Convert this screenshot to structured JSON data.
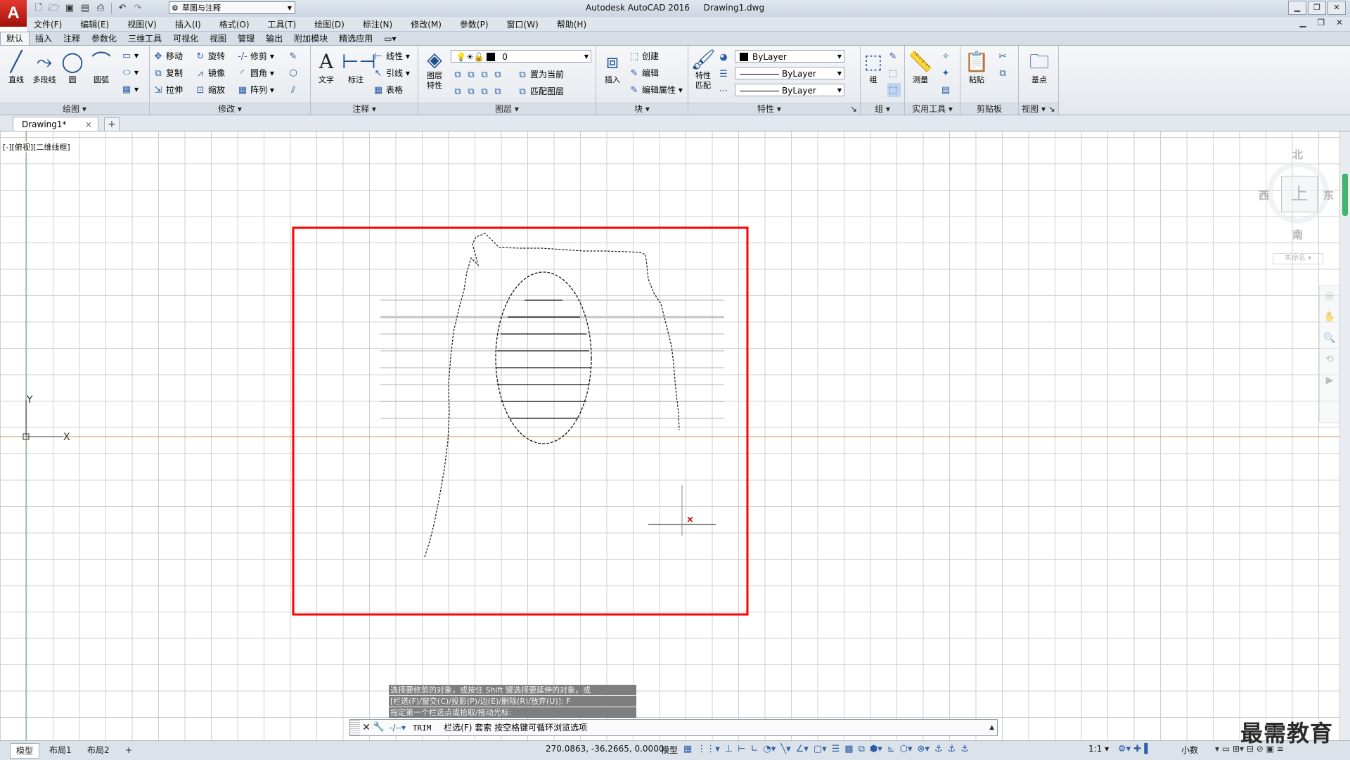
{
  "app": {
    "logo": "A",
    "title": "Autodesk AutoCAD 2016",
    "document": "Drawing1.dwg",
    "workspace": "草图与注释"
  },
  "menu": [
    "文件(F)",
    "编辑(E)",
    "视图(V)",
    "插入(I)",
    "格式(O)",
    "工具(T)",
    "绘图(D)",
    "标注(N)",
    "修改(M)",
    "参数(P)",
    "窗口(W)",
    "帮助(H)"
  ],
  "ribbon_tabs": [
    "默认",
    "插入",
    "注释",
    "参数化",
    "三维工具",
    "可视化",
    "视图",
    "管理",
    "输出",
    "附加模块",
    "精选应用"
  ],
  "active_ribbon_tab": "默认",
  "panels": {
    "draw": {
      "title": "绘图",
      "line": "直线",
      "polyline": "多段线",
      "circle": "圆",
      "arc": "圆弧"
    },
    "modify": {
      "title": "修改",
      "move": "移动",
      "rotate": "旋转",
      "trim": "修剪",
      "copy": "复制",
      "mirror": "镜像",
      "fillet": "圆角",
      "stretch": "拉伸",
      "scale": "缩放",
      "array": "阵列"
    },
    "annotation": {
      "title": "注释",
      "text": "文字",
      "dimension": "标注",
      "linear": "线性",
      "leader": "引线",
      "table": "表格"
    },
    "layers": {
      "title": "图层",
      "layer_props": "图层\n特性",
      "current_layer": "0",
      "set_current": "置为当前",
      "match_layer": "匹配图层"
    },
    "block": {
      "title": "块",
      "insert": "插入",
      "create": "创建",
      "edit": "编辑",
      "edit_attr": "编辑属性"
    },
    "properties": {
      "title": "特性",
      "match_props": "特性\n匹配",
      "color": "ByLayer",
      "linetype": "ByLayer",
      "lineweight": "ByLayer"
    },
    "groups": {
      "title": "组",
      "group": "组"
    },
    "utilities": {
      "title": "实用工具",
      "measure": "测量"
    },
    "clipboard": {
      "title": "剪贴板",
      "paste": "粘贴"
    },
    "view": {
      "title": "视图",
      "base": "基点"
    }
  },
  "file_tab": {
    "name": "Drawing1*",
    "close": "×",
    "new": "+"
  },
  "viewport_label": "[-][俯视][二维线框]",
  "ucs": {
    "x": "X",
    "y": "Y"
  },
  "viewcube": {
    "north": "北",
    "south": "南",
    "east": "东",
    "west": "西",
    "ucs_label": "未命名 ▾"
  },
  "command": {
    "history": [
      "选择要修剪的对象，或按住 Shift 键选择要延伸的对象，或",
      "[栏选(F)/窗交(C)/投影(P)/边(E)/删除(R)/放弃(U)]: F",
      "指定第一个栏选点或拾取/拖动光标:"
    ],
    "name": "TRIM",
    "prompt": "栏选(F) 套索  按空格键可循环浏览选项"
  },
  "layout_tabs": [
    "模型",
    "布局1",
    "布局2"
  ],
  "active_layout": "模型",
  "status": {
    "coords": "270.0863, -36.2665, 0.0000",
    "mode": "模型",
    "scale": "1:1 ▾",
    "units": "小数"
  },
  "watermark": "最需教育",
  "colors": {
    "boundary": "#ff0000",
    "cursor": "#cc0000",
    "ucs_x": "#b5651d",
    "ucs_y": "#2e8b2e"
  }
}
